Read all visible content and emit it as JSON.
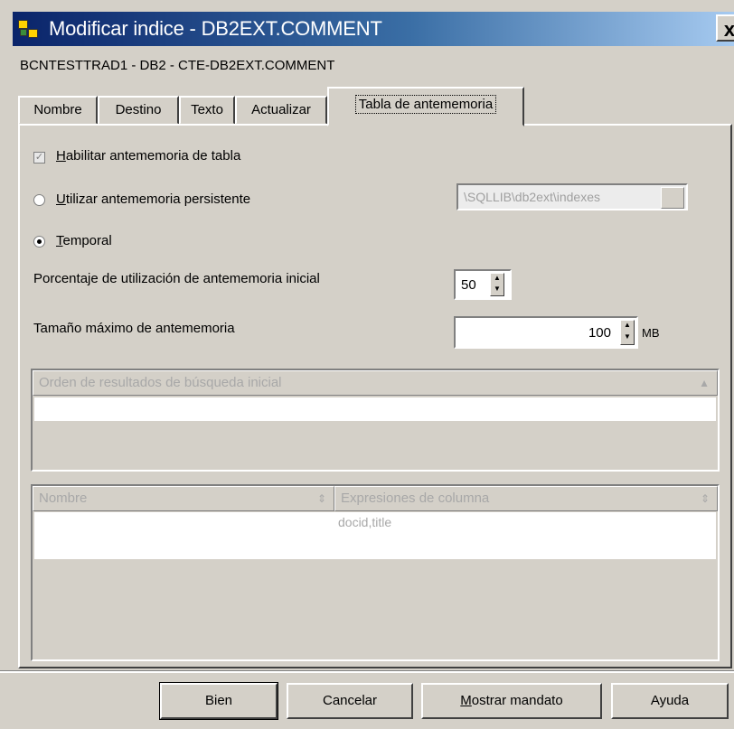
{
  "window": {
    "title": "Modificar indice - DB2EXT.COMMENT",
    "subtitle": "BCNTESTTRAD1 - DB2 - CTE-DB2EXT.COMMENT",
    "close_label": "x"
  },
  "tabs": [
    {
      "label": "Nombre"
    },
    {
      "label": "Destino"
    },
    {
      "label": "Texto"
    },
    {
      "label": "Actualizar"
    },
    {
      "label": "Tabla de antememoria",
      "active": true
    }
  ],
  "cache": {
    "enable_label_u": "H",
    "enable_label_rest": "abilitar antememoria de tabla",
    "enable_checked": true,
    "persistent_label_u": "U",
    "persistent_label_rest": "tilizar antememoria persistente",
    "persistent_path": "\\SQLLIB\\db2ext\\indexes",
    "temporal_label_u": "T",
    "temporal_label_rest": "emporal",
    "initial_pct_label": "Porcentaje de utilización de antememoria inicial",
    "initial_pct_value": "50",
    "max_size_label": "Tamaño máximo de antememoria",
    "max_size_value": "100",
    "max_size_unit": "MB"
  },
  "sort_order": {
    "header": "Orden de resultados de búsqueda inicial"
  },
  "columns_table": {
    "headers": [
      "Nombre",
      "Expresiones de columna"
    ],
    "rows": [
      {
        "name": "",
        "expression": "docid,title"
      }
    ]
  },
  "buttons": {
    "ok": "Bien",
    "cancel": "Cancelar",
    "show_command_u": "M",
    "show_command_rest": "ostrar mandato",
    "help": "Ayuda"
  }
}
